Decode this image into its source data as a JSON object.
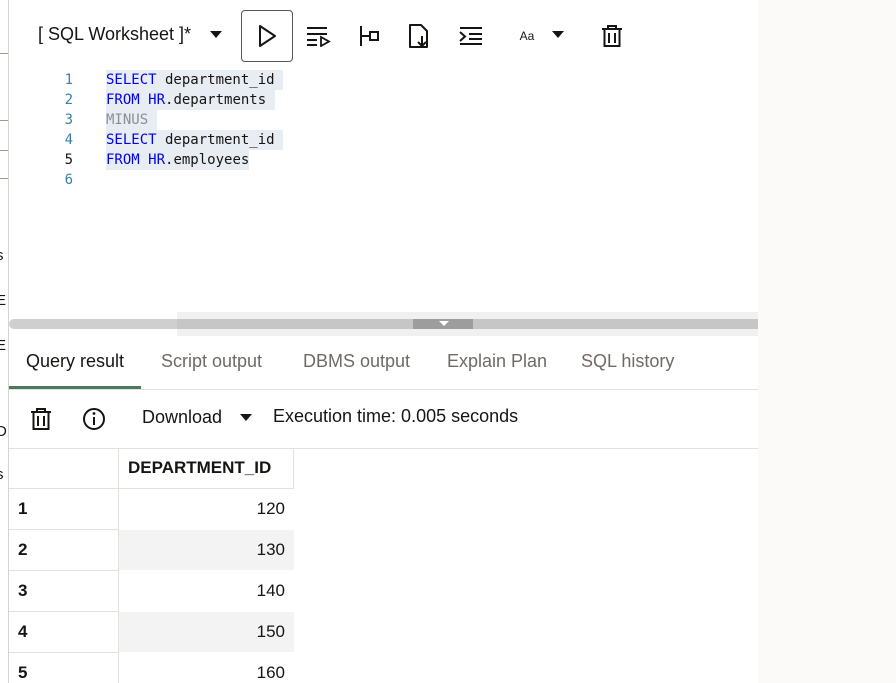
{
  "left_fragments": [
    ")",
    "s",
    "E",
    "E",
    "D",
    "s"
  ],
  "toolbar": {
    "worksheet_title": "[ SQL Worksheet ]*",
    "font_size_label": "Aa",
    "icons": [
      "run-statement-icon",
      "run-script-icon",
      "explain-plan-icon",
      "save-file-icon",
      "format-icon",
      "font-size-icon",
      "clear-icon"
    ]
  },
  "editor": {
    "lines": [
      {
        "number": "1",
        "keyword": "SELECT",
        "rest": " department_id "
      },
      {
        "number": "2",
        "keyword": "FROM",
        "schema": "HR",
        "rest": ".departments "
      },
      {
        "number": "3",
        "comment": "MINUS"
      },
      {
        "number": "4",
        "keyword": "SELECT",
        "rest": " department_id "
      },
      {
        "number": "5",
        "keyword": "FROM",
        "schema": "HR",
        "rest": ".employees"
      },
      {
        "number": "6"
      }
    ]
  },
  "tabs": [
    "Query result",
    "Script output",
    "DBMS output",
    "Explain Plan",
    "SQL history"
  ],
  "result_toolbar": {
    "download_label": "Download",
    "execution_time": "Execution time: 0.005 seconds"
  },
  "grid": {
    "columns": [
      "",
      "DEPARTMENT_ID"
    ],
    "rows": [
      {
        "n": "1",
        "value": "120"
      },
      {
        "n": "2",
        "value": "130"
      },
      {
        "n": "3",
        "value": "140"
      },
      {
        "n": "4",
        "value": "150"
      },
      {
        "n": "5",
        "value": "160"
      }
    ]
  },
  "colors": {
    "keyword": "#0000f0",
    "line_number": "#3a7fa3",
    "active_tab_underline": "#4a7a5a",
    "selection": "#e8ecf3"
  }
}
